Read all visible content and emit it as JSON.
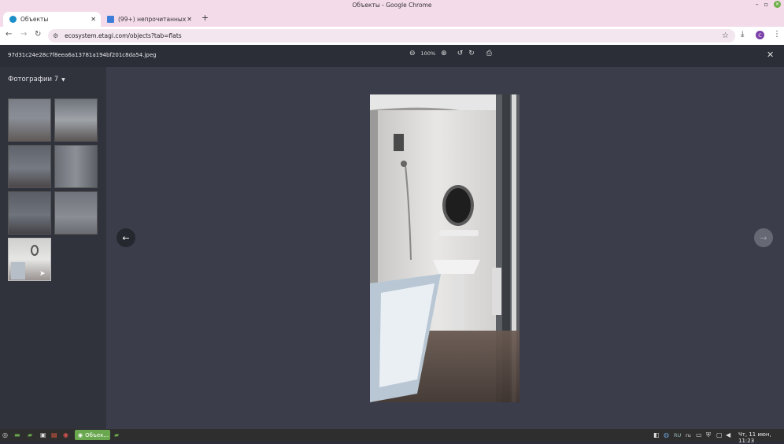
{
  "window": {
    "title": "Объекты - Google Chrome"
  },
  "tabs": [
    {
      "label": "Объекты",
      "active": true
    },
    {
      "label": "(99+) непрочитанных",
      "active": false
    }
  ],
  "address": {
    "url": "ecosystem.etagi.com/objects?tab=flats"
  },
  "profile": {
    "initial": "C"
  },
  "viewer": {
    "filename": "97d31c24e28c7f8eea6a13781a194bf201c8da54.jpeg",
    "zoom": "100%"
  },
  "sidebar": {
    "title": "Фотографии 7",
    "thumb_count": 7,
    "selected_index": 6
  },
  "taskbar": {
    "app_label": "Объек...",
    "lang": "RU",
    "lang2": "ru",
    "clock": "Чт, 11 июн, 11:23"
  },
  "colors": {
    "accent": "#7a3fa8",
    "tab_bar": "#f4dbea",
    "viewer_bg": "#3b3d4b",
    "sidebar_bg": "#30323c",
    "taskbar_app": "#6aa84f"
  }
}
